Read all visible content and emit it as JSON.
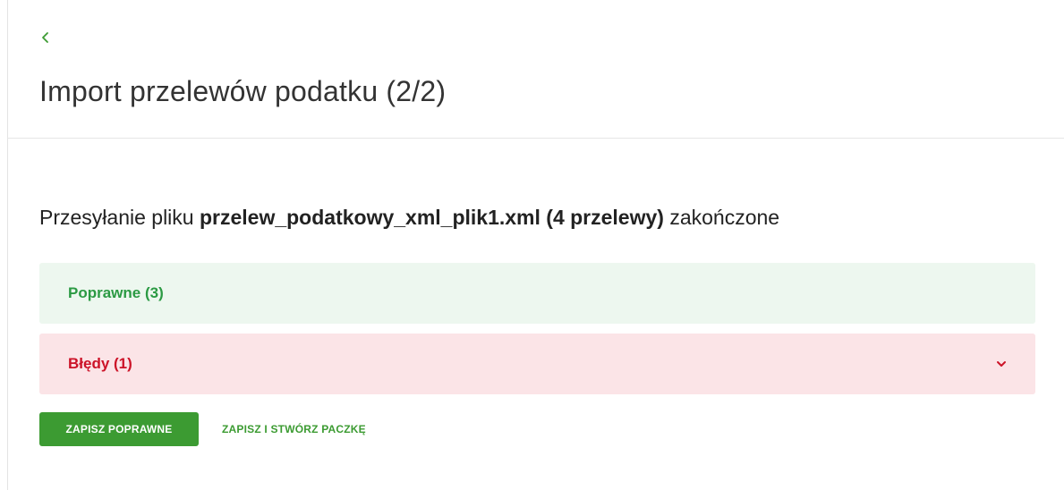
{
  "header": {
    "back_icon": "chevron-left-icon",
    "title": "Import przelewów podatku (2/2)"
  },
  "summary": {
    "prefix": "Przesyłanie pliku ",
    "filename": "przelew_podatkowy_xml_plik1.xml (4 przelewy)",
    "suffix": " zakończone"
  },
  "panels": {
    "correct": {
      "label": "Poprawne (3)",
      "color": "#2b9a43",
      "background": "#edf7ef"
    },
    "errors": {
      "label": "Błędy (1)",
      "icon": "chevron-down-icon",
      "color": "#cc1328",
      "background": "#fbe4e7"
    }
  },
  "actions": {
    "save_correct_label": "ZAPISZ POPRAWNE",
    "save_and_create_package_label": "ZAPISZ I STWÓRZ PACZKĘ",
    "accent_color": "#3c9b32"
  }
}
